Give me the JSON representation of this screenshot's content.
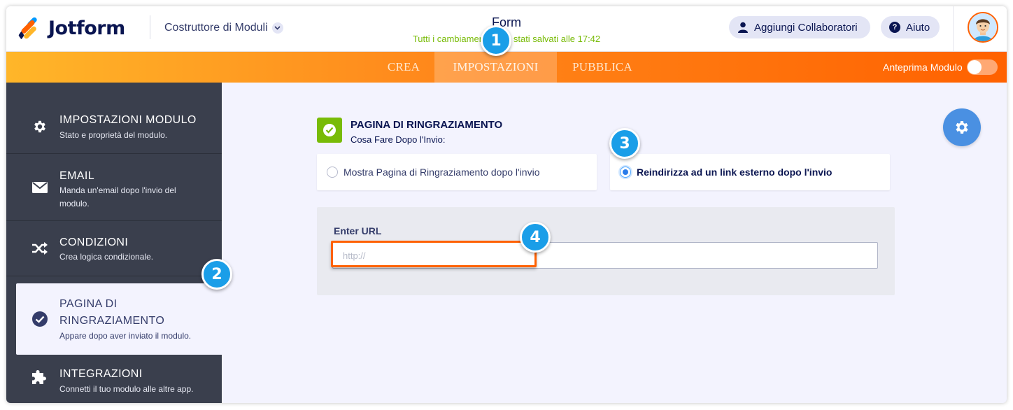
{
  "header": {
    "logo_text": "Jotform",
    "builder_label": "Costruttore di Moduli",
    "form_title": "Form",
    "saved_status": "Tutti i cambiamenti sono stati salvati alle 17:42",
    "collaborators_button": "Aggiungi Collaboratori",
    "help_button": "Aiuto"
  },
  "navbar": {
    "tabs": [
      {
        "label": "CREA",
        "active": false
      },
      {
        "label": "IMPOSTAZIONI",
        "active": true
      },
      {
        "label": "PUBBLICA",
        "active": false
      }
    ],
    "preview_label": "Anteprima Modulo",
    "preview_on": false
  },
  "sidebar": {
    "items": [
      {
        "title": "IMPOSTAZIONI MODULO",
        "desc": "Stato e proprietà del modulo.",
        "icon": "gear-icon"
      },
      {
        "title": "EMAIL",
        "desc": "Manda un'email dopo l'invio del modulo.",
        "icon": "envelope-icon"
      },
      {
        "title": "CONDIZIONI",
        "desc": "Crea logica condizionale.",
        "icon": "shuffle-icon"
      },
      {
        "title": "PAGINA DI RINGRAZIAMENTO",
        "desc": "Appare dopo aver inviato il modulo.",
        "icon": "check-circle-icon",
        "active": true
      },
      {
        "title": "INTEGRAZIONI",
        "desc": "Connetti il tuo modulo alle altre app.",
        "icon": "puzzle-icon"
      }
    ]
  },
  "main": {
    "section_title": "PAGINA DI RINGRAZIAMENTO",
    "section_subtitle": "Cosa Fare Dopo l'Invio:",
    "options": [
      {
        "label": "Mostra Pagina di Ringraziamento dopo l'invio",
        "selected": false
      },
      {
        "label": "Reindirizza ad un link esterno dopo l'invio",
        "selected": true
      }
    ],
    "url_label": "Enter URL",
    "url_placeholder": "http://",
    "url_value": ""
  },
  "markers": [
    "1",
    "2",
    "3",
    "4"
  ],
  "colors": {
    "brand_orange": "#ff6100",
    "brand_yellow": "#ffb629",
    "navy": "#0a1551",
    "sidebar_bg": "#3a3f4d",
    "success_green": "#78bb07",
    "marker_blue": "#1a9ee8",
    "gear_button_blue": "#4a90e2"
  }
}
